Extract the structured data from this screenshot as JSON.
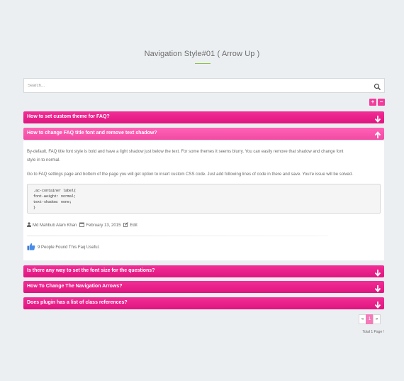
{
  "title": "Navigation Style#01 ( Arrow Up )",
  "search": {
    "placeholder": "Search..."
  },
  "controls": {
    "expand_label": "+",
    "collapse_label": "−"
  },
  "faqs": [
    {
      "question": "How to set custom theme for FAQ?",
      "state": "collapsed",
      "icon": "arrow-down-icon"
    },
    {
      "question": "How to change FAQ title font and remove text shadow?",
      "state": "expanded",
      "icon": "arrow-up-icon"
    },
    {
      "question": "Is there any way to set the font size for the questions?",
      "state": "collapsed",
      "icon": "arrow-down-icon"
    },
    {
      "question": "How To Change The Navigation Arrows?",
      "state": "collapsed",
      "icon": "arrow-down-icon"
    },
    {
      "question": "Does plugin has a list of class references?",
      "state": "collapsed",
      "icon": "arrow-down-icon"
    }
  ],
  "answer": {
    "paragraph1_line1": "By-default, FAQ title font style is bold and have a light shadow just below the text. For some themes it seems blurry. You can easily remove that shadow and change font",
    "paragraph1_line2": "style in to normal.",
    "paragraph2": "Go to FAQ settings page and bottom of the page you will get option to insert custom CSS code. Just add following lines of code in there and save. You're issue will be solved.",
    "code": [
      ".ac-container label{",
      " font-weight: normal;",
      " text-shadow: none;",
      "}"
    ],
    "author": "Md Mahbub Alam Khan",
    "date": "February 13, 2015",
    "edit": "Edit",
    "found": "9 People Found This Faq Useful."
  },
  "pagination": {
    "prev": "«",
    "current": "1",
    "next": "»",
    "total": "Total 1 Page !"
  },
  "colors": {
    "accent": "#e0157f",
    "accent_open": "#f24aa3",
    "background": "#eceff2"
  }
}
